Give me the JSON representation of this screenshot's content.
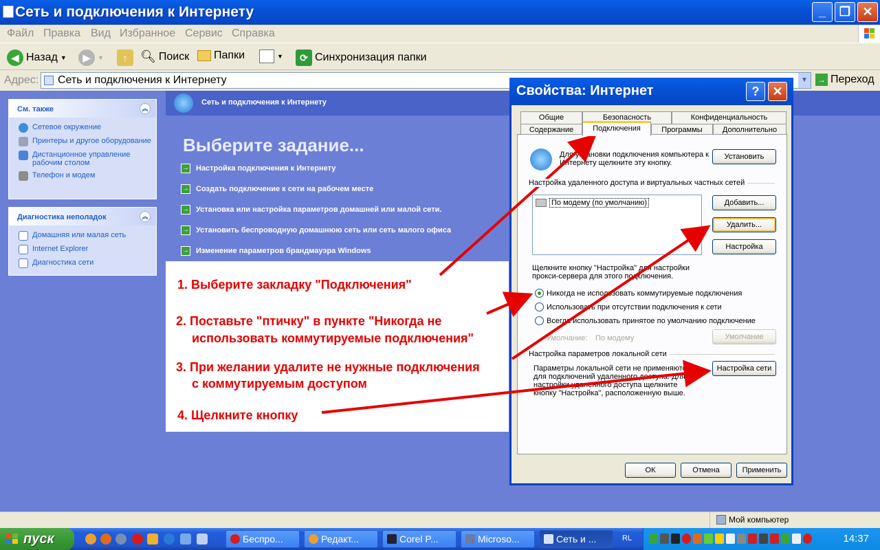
{
  "window": {
    "title": "Сеть и подключения к Интернету",
    "minimize": "_",
    "restore": "❐",
    "close": "✕"
  },
  "menu": [
    "Файл",
    "Правка",
    "Вид",
    "Избранное",
    "Сервис",
    "Справка"
  ],
  "toolbar": {
    "back": "Назад",
    "search": "Поиск",
    "folders": "Папки",
    "sync": "Синхронизация папки"
  },
  "address": {
    "label": "Адрес:",
    "value": "Сеть и подключения к Интернету",
    "go": "Переход"
  },
  "see_also": {
    "title": "См. также",
    "items": [
      "Сетевое окружение",
      "Принтеры и другое оборудование",
      "Дистанционное управление рабочим столом",
      "Телефон и модем"
    ]
  },
  "troubleshoot": {
    "title": "Диагностика неполадок",
    "items": [
      "Домашняя или малая сеть",
      "Internet Explorer",
      "Диагностика сети"
    ]
  },
  "main": {
    "header": "Сеть и подключения к Интернету",
    "title": "Выберите задание...",
    "tasks": [
      "Настройка подключения к Интернету",
      "Создать подключение к сети на рабочем месте",
      "Установка или настройка параметров домашней или малой сети.",
      "Установить беспроводную домашнюю сеть или сеть малого офиса",
      "Изменение параметров брандмауэра Windows"
    ]
  },
  "instructions": {
    "step1": "1. Выберите закладку \"Подключения\"",
    "step2a": "2. Поставьте \"птичку\" в пункте \"Никогда не",
    "step2b": "использовать коммутируемые подключения\"",
    "step3a": "3. При желании удалите не нужные подключения",
    "step3b": "с коммутируемым доступом",
    "step4": "4. Щелкните кнопку"
  },
  "status": {
    "computer": "Мой компьютер"
  },
  "dialog": {
    "title": "Свойства: Интернет",
    "help": "?",
    "close": "✕",
    "tabs_back": [
      "Общие",
      "Безопасность",
      "Конфиденциальность"
    ],
    "tabs_front": [
      "Содержание",
      "Подключения",
      "Программы",
      "Дополнительно"
    ],
    "setup_text": "Для установки подключения компьютера к Интернету щелкните эту кнопку.",
    "setup_button": "Установить",
    "dialup_group": "Настройка удаленного доступа и виртуальных частных сетей",
    "connection_item": "По модему (по умолчанию)",
    "add_button": "Добавить...",
    "remove_button": "Удалить...",
    "settings_button": "Настройка",
    "proxy_text": "Щелкните кнопку \"Настройка\" для настройки прокси-сервера для этого подключения.",
    "radio_never": "Никогда не использовать коммутируемые подключения",
    "radio_when_none": "Использовать при отсутствии подключения к сети",
    "radio_always": "Всегда использовать принятое по умолчанию подключение",
    "default_label": "Умолчание:",
    "default_value": "По модему",
    "default_button": "Умолчание",
    "lan_group": "Настройка параметров локальной сети",
    "lan_text": "Параметры локальной сети не применяются для подключений удаленного доступа. Для настройки удаленного доступа щелкните кнопку \"Настройка\", расположенную выше.",
    "lan_button": "Настройка сети",
    "ok": "ОК",
    "cancel": "Отмена",
    "apply": "Применить"
  },
  "taskbar": {
    "start": "пуск",
    "buttons": [
      "Беспро...",
      "Редакт...",
      "Corel P...",
      "Microso...",
      "Сеть и ..."
    ],
    "lang": "RL",
    "clock": "14:37"
  },
  "colors": {
    "accent": "#0a5fe8",
    "annotation": "#e60000",
    "pane": "#6b7fd6"
  }
}
